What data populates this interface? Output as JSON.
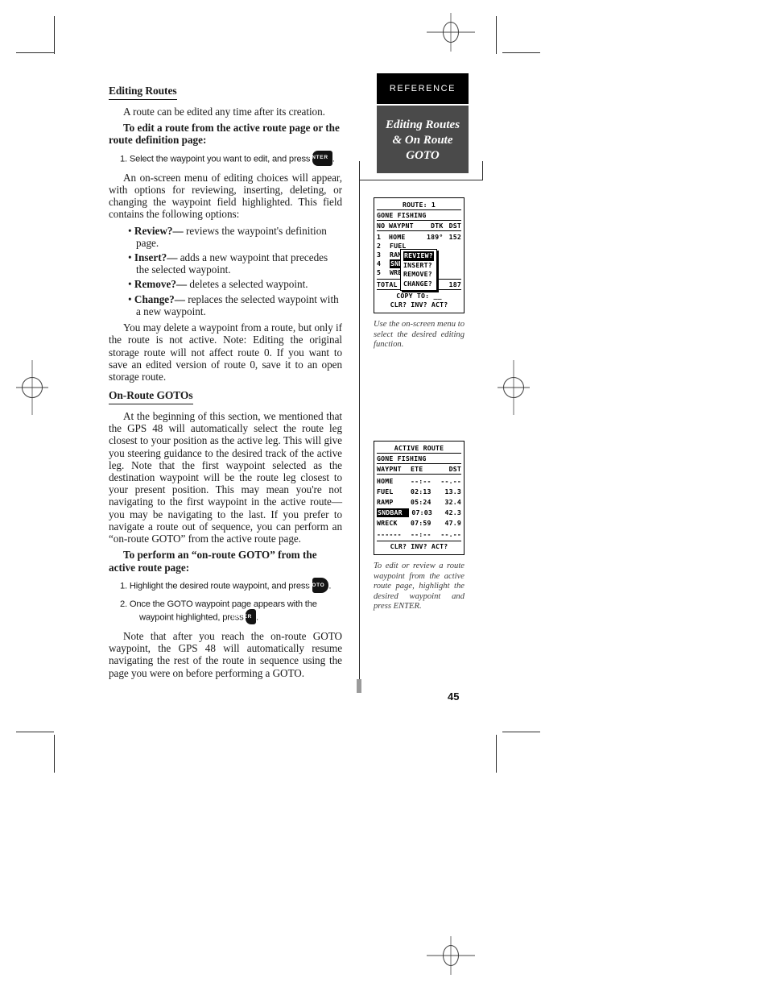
{
  "page": {
    "number": "45",
    "tab_label": "REFERENCE",
    "tab_title_line1": "Editing Routes",
    "tab_title_line2": "& On Route",
    "tab_title_line3": "GOTO"
  },
  "content": {
    "section1": {
      "heading": "Editing Routes",
      "intro": "A route can be edited any time after its creation.",
      "procedure_title": "To edit a route from the active route page or the route definition page:",
      "step1_pre": "1. Select the waypoint you want to edit, and press",
      "step1_key": "ENTER",
      "step1_post": ".",
      "para2": "An on-screen menu of editing choices will appear, with options for reviewing, inserting, deleting, or changing the waypoint field highlighted.  This field contains the following options:",
      "options": [
        {
          "term": "Review?—",
          "desc": " reviews the waypoint's definition page."
        },
        {
          "term": "Insert?—",
          "desc": " adds a new waypoint that precedes the selected waypoint."
        },
        {
          "term": "Remove?—",
          "desc": " deletes a selected waypoint."
        },
        {
          "term": "Change?—",
          "desc": " replaces the selected waypoint with a new waypoint."
        }
      ],
      "para3": "You may delete a waypoint from a route, but only if the route is not active. Note: Editing the original storage route will not affect route 0. If you want to save an edited version of route 0, save it to an open storage route."
    },
    "section2": {
      "heading": "On-Route GOTOs",
      "para1": "At the beginning of this section, we mentioned that the GPS 48 will automatically select the route leg closest to your position as the active leg.  This will give you steering guidance to the desired track of the active leg.  Note that the first waypoint selected as the destination waypoint will be the route leg closest to your present position.  This may mean you're not navigating to the first waypoint in the active route—you may be navigating to the last.  If you prefer to navigate a route out of sequence, you can perform an “on-route GOTO” from the active route page.",
      "procedure_title": "To perform an “on-route GOTO” from the active route page:",
      "step1_pre": "1. Highlight the desired route waypoint, and press",
      "step1_key": "GOTO",
      "step1_post": ".",
      "step2_pre": "2. Once the GOTO waypoint page appears with the waypoint highlighted, press",
      "step2_key": "ENTER",
      "step2_post": ".",
      "para2": "Note that after you reach the on-route GOTO waypoint, the GPS 48 will automatically resume navigating the rest of the route in sequence using the page you were on before performing a GOTO."
    }
  },
  "figures": [
    {
      "id": "route-definition-page",
      "screen": {
        "title": "ROUTE:  1",
        "route_name": "GONE FISHING",
        "headers": {
          "no": "NO",
          "waypoint": "WAYPNT",
          "dtk": "DTK",
          "dst": "DST"
        },
        "rows": [
          {
            "no": "1",
            "name": "HOME",
            "dtk": "189°",
            "dst": "152"
          },
          {
            "no": "2",
            "name": "FUEL",
            "dtk": "",
            "dst": ""
          },
          {
            "no": "3",
            "name": "RAMP",
            "dtk": "",
            "dst": ""
          },
          {
            "no": "4",
            "name": "SNDBAR",
            "dtk": "",
            "dst": "",
            "highlight": true
          },
          {
            "no": "5",
            "name": "WRECK",
            "dtk": "",
            "dst": ""
          }
        ],
        "total_label": "TOTAL DST",
        "total_value": "187",
        "copy_to": "COPY TO: __",
        "footer": "CLR? INV? ACT?",
        "popup_items": [
          {
            "label": "REVIEW?",
            "selected": true
          },
          {
            "label": "INSERT?",
            "selected": false
          },
          {
            "label": "REMOVE?",
            "selected": false
          },
          {
            "label": "CHANGE?",
            "selected": false
          }
        ]
      },
      "caption": "Use the on-screen menu to select the desired editing function."
    },
    {
      "id": "active-route-page",
      "screen": {
        "title": "ACTIVE ROUTE",
        "route_name": "GONE FISHING",
        "headers": {
          "waypoint": "WAYPNT",
          "ete": "ETE",
          "dst": "DST"
        },
        "rows": [
          {
            "name": "HOME",
            "ete": "--:--",
            "dst": "--.--",
            "highlight": false
          },
          {
            "name": "FUEL",
            "ete": "02:13",
            "dst": "13.3",
            "highlight": false
          },
          {
            "name": "RAMP",
            "ete": "05:24",
            "dst": "32.4",
            "highlight": false
          },
          {
            "name": "SNDBAR",
            "ete": "07:03",
            "dst": "42.3",
            "highlight": true
          },
          {
            "name": "WRECK",
            "ete": "07:59",
            "dst": "47.9",
            "highlight": false
          },
          {
            "name": "------",
            "ete": "--:--",
            "dst": "--.--",
            "highlight": false
          }
        ],
        "footer": "CLR? INV? ACT?"
      },
      "caption": "To edit or review a route waypoint from the active route page, highlight the desired waypoint and press ENTER."
    }
  ]
}
